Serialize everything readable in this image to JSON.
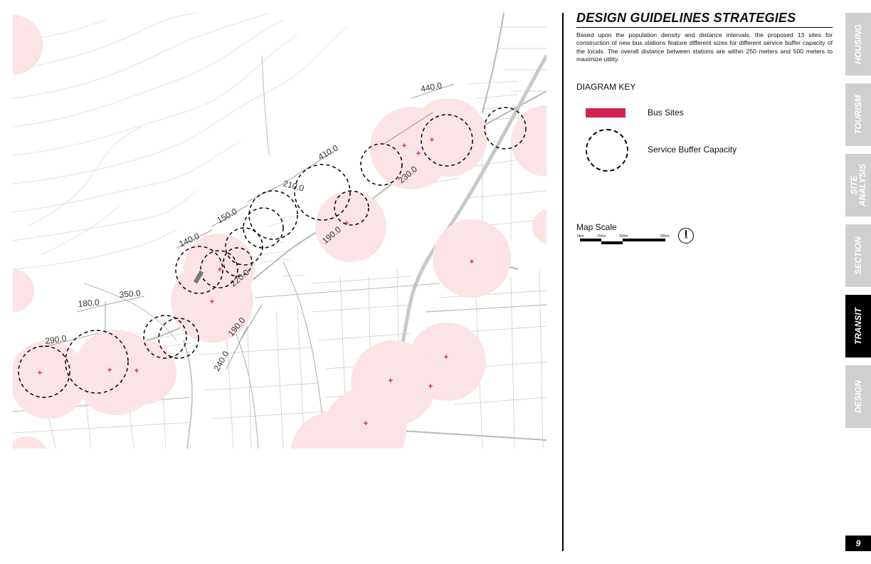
{
  "title": "DESIGN GUIDELINES STRATEGIES",
  "description": "Based upon the population density and distance intervals, the proposed 13 sites for construction of new bus stations feature different sizes for different service buffer capacity of the locals. The overall distance between stations are within 250 meters and 500 meters to maximize utility.",
  "diagram_key": {
    "title": "DIAGRAM KEY",
    "bus_sites_label": "Bus Sites",
    "buffer_label": "Service Buffer Capacity",
    "bus_site_color": "#d0234e",
    "buffer_fill_color": "#fbe3e6"
  },
  "map_scale": {
    "title": "Map Scale",
    "ticks": [
      "0km",
      "150m",
      "300m",
      "600m"
    ],
    "north_label": "N"
  },
  "map": {
    "distance_labels": [
      "440.0",
      "410.0",
      "210.0",
      "230.0",
      "150.0",
      "140.0",
      "190.0",
      "220.0",
      "180.0",
      "350.0",
      "290.0",
      "190.0",
      "240.0"
    ],
    "site_marker": "+"
  },
  "tabs": [
    "HOUSING",
    "TOURISM",
    "SITE\nANALYSIS",
    "SECTION",
    "TRANSIT",
    "DESIGN"
  ],
  "active_tab": "TRANSIT",
  "page_number": "9"
}
